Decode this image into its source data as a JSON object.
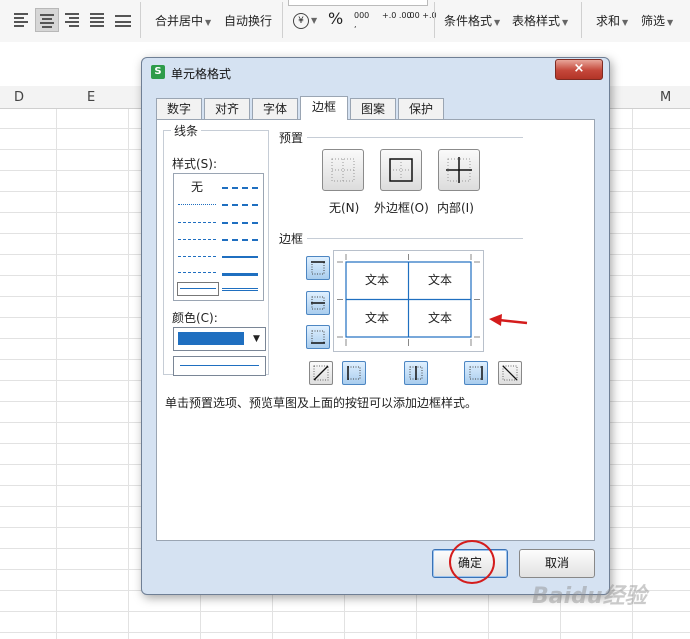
{
  "ribbon": {
    "merge_center": "合并居中",
    "wrap_text": "自动换行",
    "percent": "%",
    "thousands": "000",
    "inc_decimal": "+.0 .00",
    "dec_decimal": ".00 +.0",
    "currency": "¥",
    "conditional_format": "条件格式",
    "table_style": "表格样式",
    "sum": "求和",
    "filter": "筛选"
  },
  "sheet": {
    "columns": [
      "D",
      "E",
      "M"
    ]
  },
  "dialog": {
    "title": "单元格格式",
    "app_icon": "S",
    "close": "×",
    "tabs": [
      {
        "label": "数字"
      },
      {
        "label": "对齐"
      },
      {
        "label": "字体"
      },
      {
        "label": "边框"
      },
      {
        "label": "图案"
      },
      {
        "label": "保护"
      }
    ],
    "active_tab": "边框",
    "line_group": {
      "title": "线条",
      "style_label": "样式(S):",
      "none_label": "无",
      "color_label": "颜色(C):",
      "color_value": "#1f6fc0"
    },
    "preset_group": {
      "title": "预置",
      "none_label": "无(N)",
      "outline_label": "外边框(O)",
      "inside_label": "内部(I)"
    },
    "border_group": {
      "title": "边框",
      "cells": [
        "文本",
        "文本",
        "文本",
        "文本"
      ]
    },
    "hint": "单击预置选项、预览草图及上面的按钮可以添加边框样式。",
    "ok": "确定",
    "cancel": "取消"
  },
  "watermark": "Baidu经验",
  "colors": {
    "accent": "#1f6fc0",
    "annotation_red": "#d41c1c",
    "dialog_bg": "#d5e2f2"
  }
}
